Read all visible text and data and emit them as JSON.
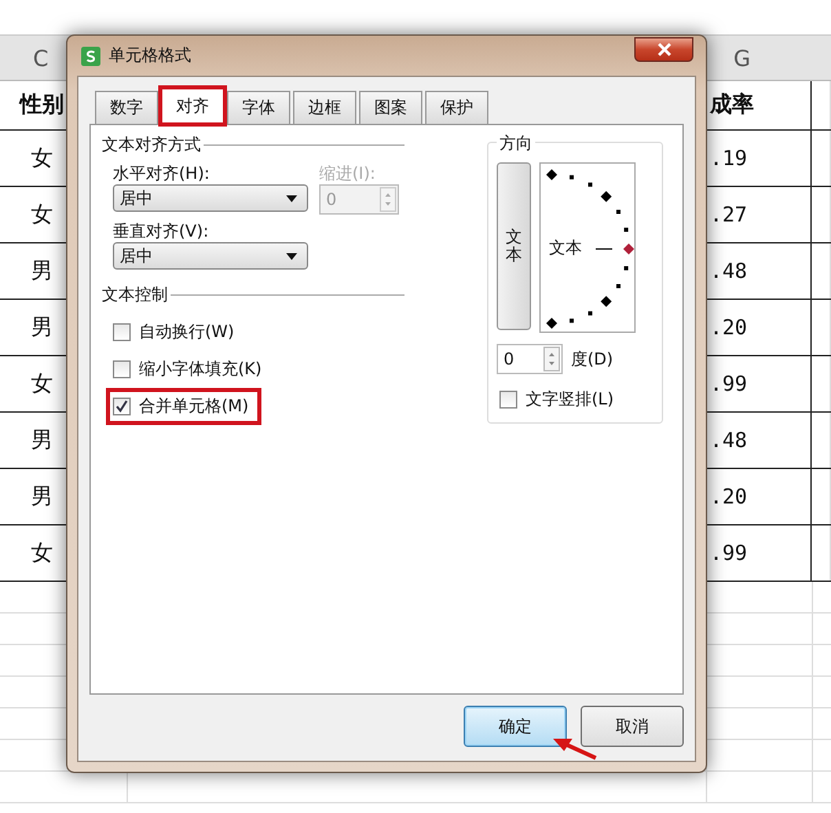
{
  "sheet": {
    "columns": [
      {
        "label": "C"
      },
      {
        "label": "G"
      }
    ],
    "header": [
      "性别",
      "成率"
    ],
    "rows": [
      [
        "女",
        ".19"
      ],
      [
        "女",
        ".27"
      ],
      [
        "男",
        ".48"
      ],
      [
        "男",
        ".20"
      ],
      [
        "女",
        ".99"
      ],
      [
        "男",
        ".48"
      ],
      [
        "男",
        ".20"
      ],
      [
        "女",
        ".99"
      ]
    ]
  },
  "dialog": {
    "title": "单元格格式",
    "tabs": [
      {
        "label": "数字",
        "selected": false,
        "highlighted": false
      },
      {
        "label": "对齐",
        "selected": true,
        "highlighted": true
      },
      {
        "label": "字体",
        "selected": false,
        "highlighted": false
      },
      {
        "label": "边框",
        "selected": false,
        "highlighted": false
      },
      {
        "label": "图案",
        "selected": false,
        "highlighted": false
      },
      {
        "label": "保护",
        "selected": false,
        "highlighted": false
      }
    ],
    "alignment": {
      "title": "文本对齐方式",
      "horizontal": {
        "label": "水平对齐(H):",
        "value": "居中"
      },
      "indent": {
        "label": "缩进(I):",
        "value": "0",
        "disabled": true
      },
      "vertical": {
        "label": "垂直对齐(V):",
        "value": "居中"
      }
    },
    "text_control": {
      "title": "文本控制",
      "options": [
        {
          "label": "自动换行(W)",
          "checked": false,
          "highlighted": false
        },
        {
          "label": "缩小字体填充(K)",
          "checked": false,
          "highlighted": false
        },
        {
          "label": "合并单元格(M)",
          "checked": true,
          "highlighted": true
        }
      ]
    },
    "orientation": {
      "title": "方向",
      "vertical_text_button": "文本",
      "dial_label": "文本",
      "degrees": {
        "value": "0",
        "label": "度(D)"
      },
      "stacked": {
        "label": "文字竖排(L)",
        "checked": false
      }
    },
    "buttons": [
      {
        "label": "确定",
        "default": true,
        "pointed": true
      },
      {
        "label": "取消",
        "default": false,
        "pointed": false
      }
    ]
  }
}
